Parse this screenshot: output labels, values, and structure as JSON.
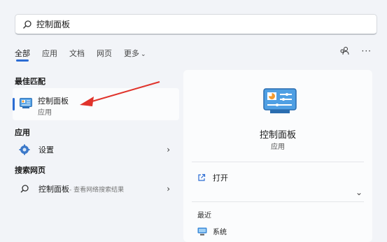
{
  "search": {
    "value": "控制面板"
  },
  "tabs": [
    {
      "label": "全部"
    },
    {
      "label": "应用"
    },
    {
      "label": "文档"
    },
    {
      "label": "网页"
    },
    {
      "label": "更多"
    }
  ],
  "sections": {
    "best_match": "最佳匹配",
    "apps": "应用",
    "web": "搜索网页"
  },
  "best_match_item": {
    "name": "控制面板",
    "type": "应用"
  },
  "apps_item": {
    "name": "设置"
  },
  "web_item": {
    "name": "控制面板",
    "suffix": " - 查看网络搜索结果"
  },
  "detail": {
    "name": "控制面板",
    "type": "应用",
    "open_label": "打开",
    "recent_label": "最近",
    "recent_item": "系统"
  },
  "colors": {
    "accent": "#2b6cd3",
    "arrow": "#e0332b"
  }
}
